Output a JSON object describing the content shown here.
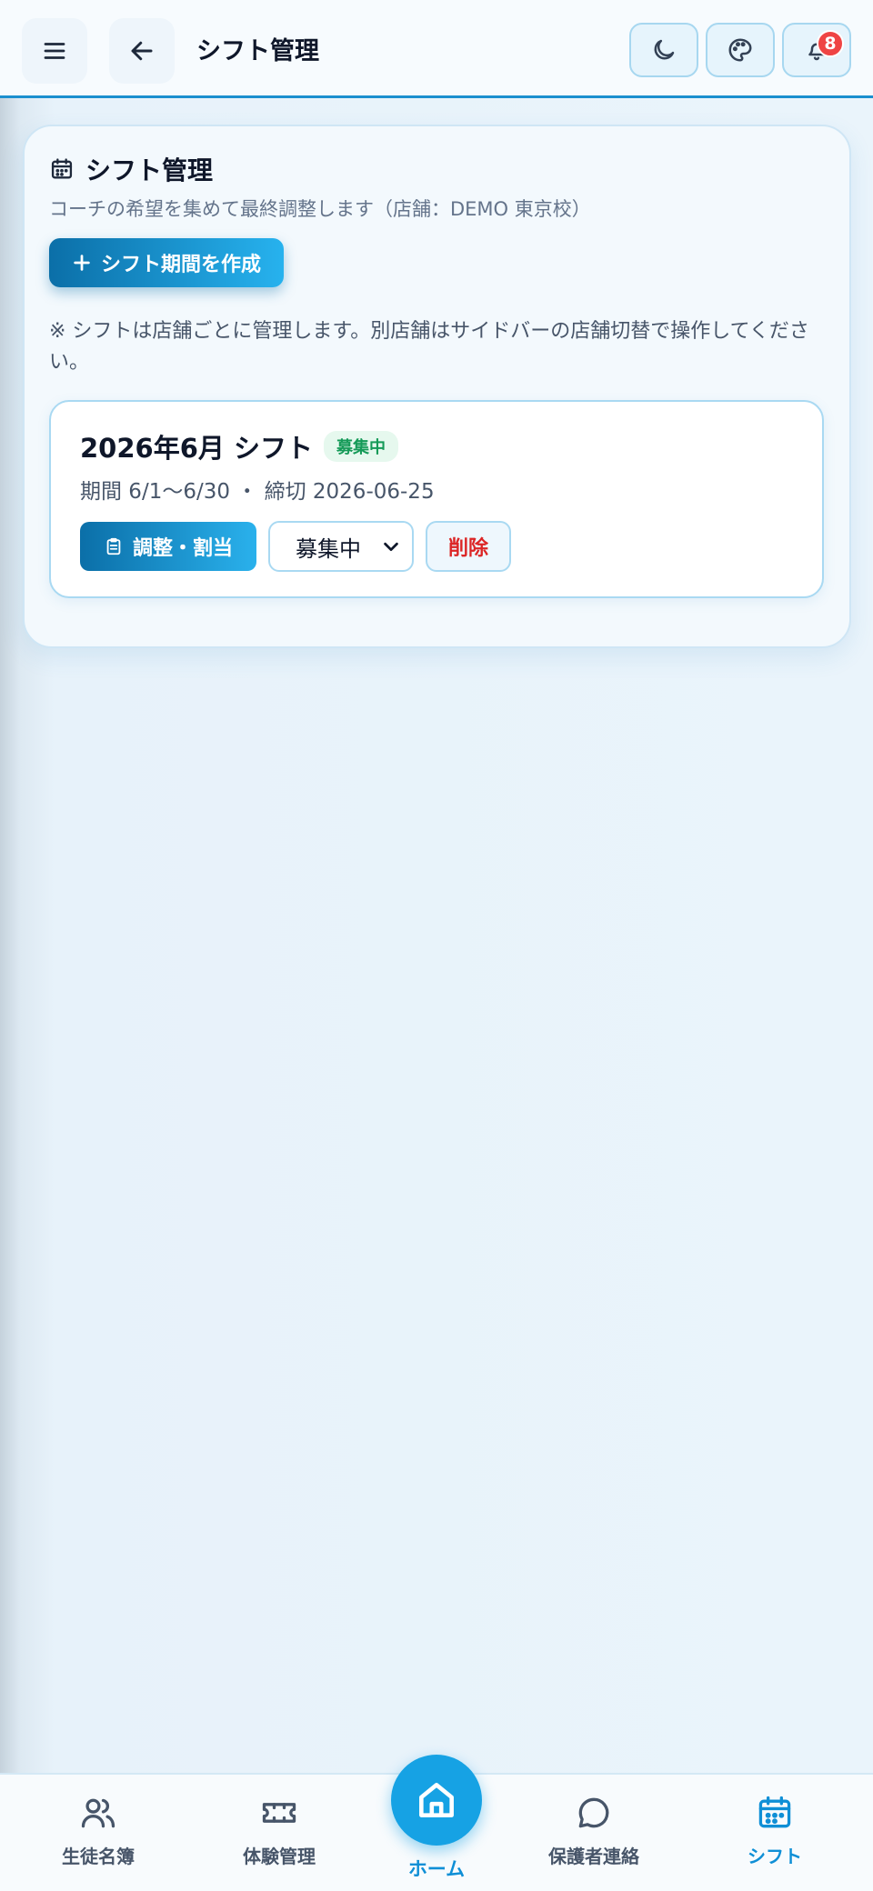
{
  "header": {
    "title": "シフト管理",
    "menu_icon": "hamburger-icon",
    "back_icon": "arrow-left-icon",
    "actions": [
      {
        "icon": "moon-icon"
      },
      {
        "icon": "palette-icon"
      },
      {
        "icon": "bell-icon",
        "badge": "8"
      }
    ]
  },
  "main": {
    "title": "シフト管理",
    "description": "コーチの希望を集めて最終調整します（店舗：DEMO 東京校）",
    "create_button": "シフト期間を作成",
    "note": "※ シフトは店舗ごとに管理します。別店舗はサイドバーの店舗切替で操作してください。",
    "periods": [
      {
        "title": "2026年6月 シフト",
        "status_badge": "募集中",
        "meta": "期間 6/1〜6/30 ・ 締切 2026-06-25",
        "assign_button": "調整・割当",
        "status_select": "募集中",
        "delete_button": "削除"
      }
    ]
  },
  "bottom_nav": {
    "items": [
      {
        "label": "生徒名簿",
        "icon": "users-icon"
      },
      {
        "label": "体験管理",
        "icon": "ticket-icon"
      },
      {
        "label": "ホーム",
        "icon": "home-icon"
      },
      {
        "label": "保護者連絡",
        "icon": "chat-icon"
      },
      {
        "label": "シフト",
        "icon": "calendar-icon",
        "active": true
      }
    ]
  },
  "colors": {
    "accent": "#16a2e4",
    "danger": "#dc2626",
    "success": "#159a58"
  }
}
